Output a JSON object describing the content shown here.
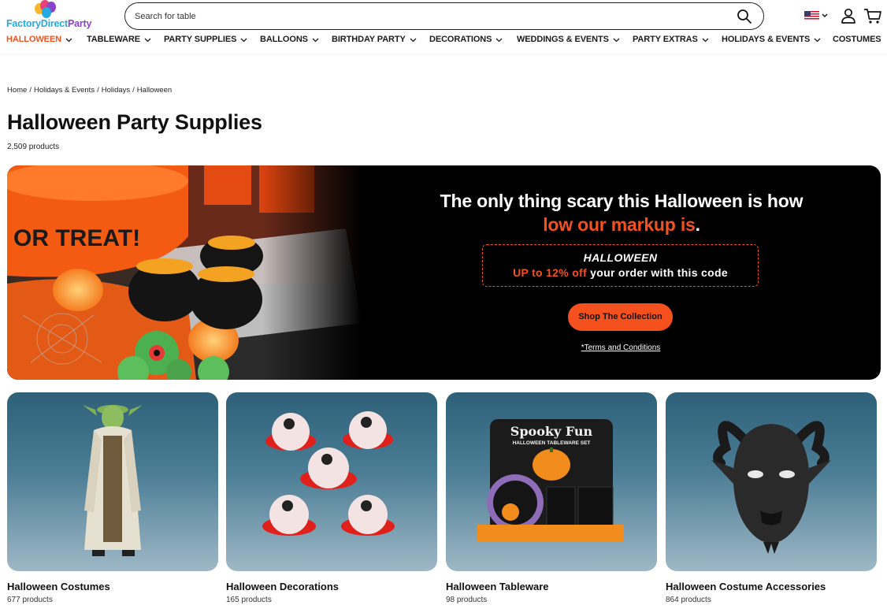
{
  "header": {
    "logo": {
      "part1": "Factory",
      "part2": "Direct",
      "part3": "Party"
    },
    "search": {
      "placeholder": "Search for table"
    },
    "icons": {
      "search": "search-icon",
      "flag": "us-flag-icon",
      "account": "user-icon",
      "cart": "cart-icon"
    }
  },
  "nav": {
    "items": [
      {
        "label": "HALLOWEEN",
        "active": true
      },
      {
        "label": "TABLEWARE"
      },
      {
        "label": "PARTY SUPPLIES"
      },
      {
        "label": "BALLOONS"
      },
      {
        "label": "BIRTHDAY PARTY"
      },
      {
        "label": "DECORATIONS"
      },
      {
        "label": "WEDDINGS & EVENTS"
      },
      {
        "label": "PARTY EXTRAS"
      },
      {
        "label": "HOLIDAYS & EVENTS"
      },
      {
        "label": "COSTUMES"
      }
    ]
  },
  "breadcrumb": [
    "Home",
    "Holidays & Events",
    "Holidays",
    "Halloween"
  ],
  "page": {
    "title": "Halloween Party Supplies",
    "count": "2,509 products"
  },
  "banner": {
    "headline_part1": "The only thing scary this Halloween is how",
    "headline_highlight": "low our markup is",
    "headline_end": ".",
    "code_title": "HALLOWEEN",
    "code_highlight": "UP to 12% off",
    "code_rest": " your order with this code",
    "button": "Shop The Collection",
    "terms": "*Terms and Conditions"
  },
  "cards": [
    {
      "title": "Halloween Costumes",
      "count": "677 products"
    },
    {
      "title": "Halloween Decorations",
      "count": "165 products"
    },
    {
      "title": "Halloween Tableware",
      "count": "98 products",
      "box_title": "Spooky Fun",
      "box_sub": "HALLOWEEN TABLEWARE SET"
    },
    {
      "title": "Halloween Costume Accessories",
      "count": "864 products"
    }
  ],
  "colors": {
    "accent": "#f4511e",
    "banner_bg": "#000000",
    "card_bg": "#3a6d86"
  }
}
